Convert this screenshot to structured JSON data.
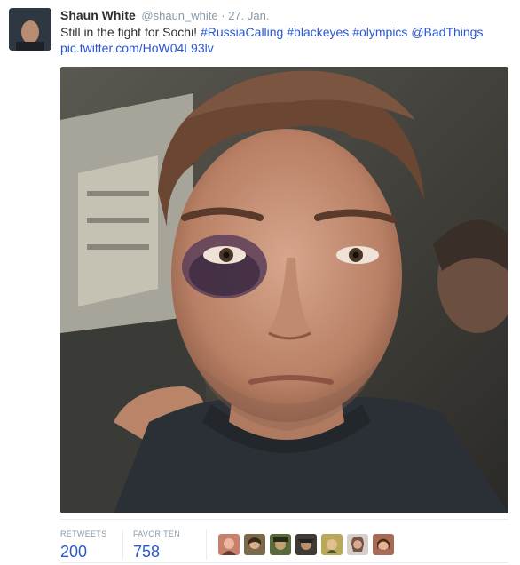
{
  "tweet": {
    "fullname": "Shaun White",
    "username": "@shaun_white",
    "separator": "·",
    "time": "27. Jan.",
    "text_start": "Still in the fight for Sochi! ",
    "hashtags": [
      "#RussiaCalling",
      "#blackeyes",
      "#olympics"
    ],
    "mention": "@BadThings",
    "pic_link": "pic.twitter.com/HoW04L93lv",
    "avatar_icon": "profile-photo",
    "photo_icon": "selfie-photo-black-eye"
  },
  "stats": {
    "retweets_label": "RETWEETS",
    "retweets_value": "200",
    "favorites_label": "FAVORITEN",
    "favorites_value": "758"
  },
  "favoriters": {
    "count_shown": 7,
    "colors": [
      "#c9806a",
      "#7a6a4a",
      "#5b6a3a",
      "#3f3a33",
      "#b9a75a",
      "#8b5a4a",
      "#a66a55"
    ]
  },
  "colors": {
    "link": "#2a57d3",
    "muted": "#8899a6",
    "text": "#292f33"
  }
}
